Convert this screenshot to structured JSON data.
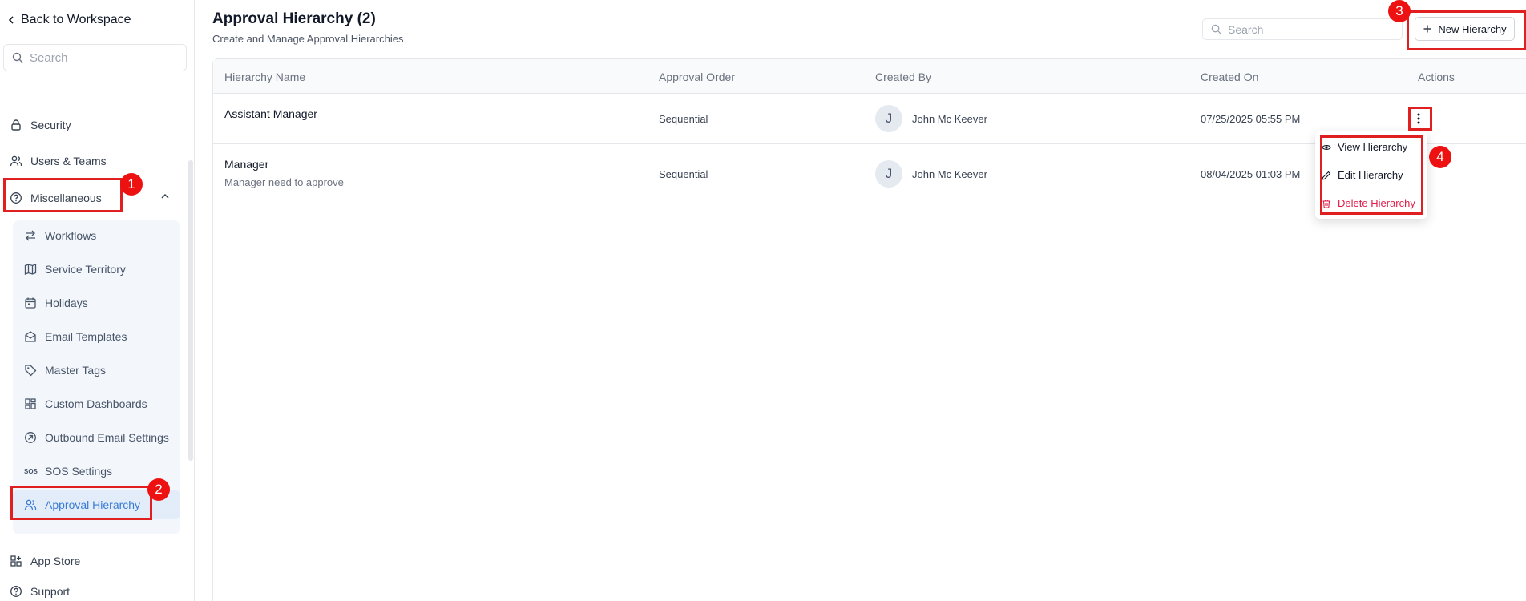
{
  "sidebar": {
    "back_label": "Back to Workspace",
    "search_placeholder": "Search",
    "items": {
      "security": "Security",
      "users_teams": "Users & Teams",
      "miscellaneous": "Miscellaneous",
      "app_store": "App Store",
      "support": "Support"
    },
    "submenu": [
      {
        "label": "Workflows",
        "icon": "workflow-icon"
      },
      {
        "label": "Service Territory",
        "icon": "map-icon"
      },
      {
        "label": "Holidays",
        "icon": "calendar-icon"
      },
      {
        "label": "Email Templates",
        "icon": "mail-icon"
      },
      {
        "label": "Master Tags",
        "icon": "tag-icon"
      },
      {
        "label": "Custom Dashboards",
        "icon": "dashboard-icon"
      },
      {
        "label": "Outbound Email Settings",
        "icon": "outbound-icon"
      },
      {
        "label": "SOS Settings",
        "icon": "sos-icon"
      },
      {
        "label": "Approval Hierarchy",
        "icon": "users-icon",
        "active": true
      }
    ]
  },
  "header": {
    "title": "Approval Hierarchy (2)",
    "subtitle": "Create and Manage Approval Hierarchies",
    "search_placeholder": "Search",
    "new_button": "New Hierarchy"
  },
  "table": {
    "columns": [
      "Hierarchy Name",
      "Approval Order",
      "Created By",
      "Created On",
      "Actions"
    ],
    "rows": [
      {
        "name": "Assistant Manager",
        "description": "",
        "order": "Sequential",
        "avatar": "J",
        "created_by": "John Mc Keever",
        "created_on": "07/25/2025 05:55 PM"
      },
      {
        "name": "Manager",
        "description": "Manager need to approve",
        "order": "Sequential",
        "avatar": "J",
        "created_by": "John Mc Keever",
        "created_on": "08/04/2025 01:03 PM"
      }
    ]
  },
  "action_menu": {
    "view": "View Hierarchy",
    "edit": "Edit Hierarchy",
    "delete": "Delete Hierarchy"
  },
  "annotations": [
    "1",
    "2",
    "3",
    "4"
  ],
  "colors": {
    "accent": "#3a7bd5",
    "danger": "#e11d48",
    "annotation": "#e02020"
  }
}
